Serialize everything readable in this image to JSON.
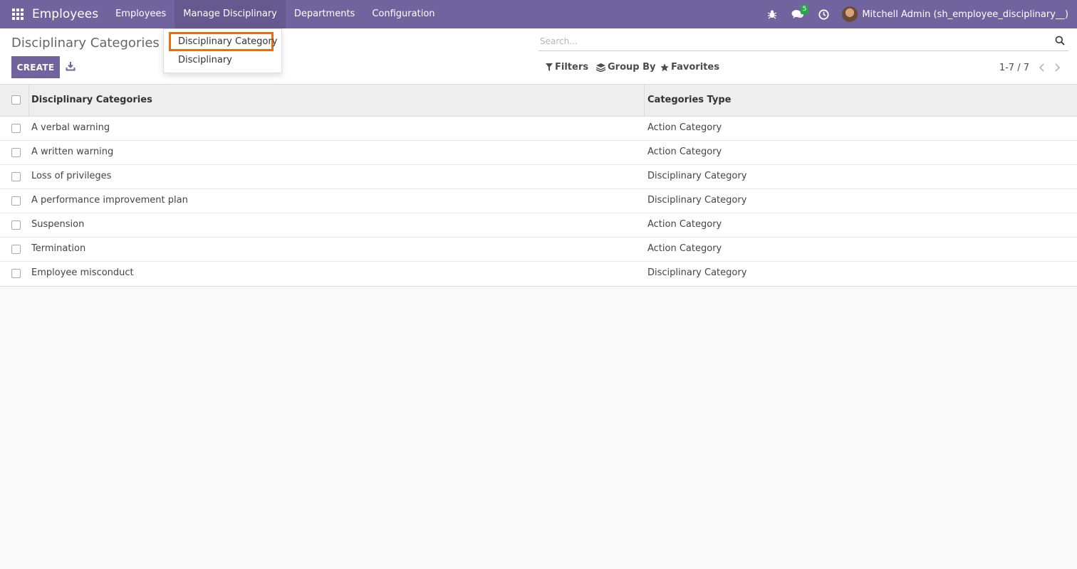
{
  "navbar": {
    "brand": "Employees",
    "menu": [
      "Employees",
      "Manage Disciplinary",
      "Departments",
      "Configuration"
    ],
    "messages_badge": "5",
    "user_name": "Mitchell Admin (sh_employee_disciplinary__)"
  },
  "dropdown": {
    "items": [
      "Disciplinary Category",
      "Disciplinary"
    ]
  },
  "control_panel": {
    "title": "Disciplinary Categories",
    "create_label": "CREATE",
    "search_placeholder": "Search...",
    "filters_label": "Filters",
    "groupby_label": "Group By",
    "favorites_label": "Favorites",
    "pager": "1-7 / 7"
  },
  "table": {
    "headers": [
      "Disciplinary Categories",
      "Categories Type"
    ],
    "rows": [
      [
        "A verbal warning",
        "Action Category"
      ],
      [
        "A written warning",
        "Action Category"
      ],
      [
        "Loss of privileges",
        "Disciplinary Category"
      ],
      [
        "A performance improvement plan",
        "Disciplinary Category"
      ],
      [
        "Suspension",
        "Action Category"
      ],
      [
        "Termination",
        "Action Category"
      ],
      [
        "Employee misconduct",
        "Disciplinary Category"
      ]
    ]
  },
  "colors": {
    "navbar": "#71639e",
    "highlight": "#f06a0f",
    "badge": "#28a745"
  }
}
